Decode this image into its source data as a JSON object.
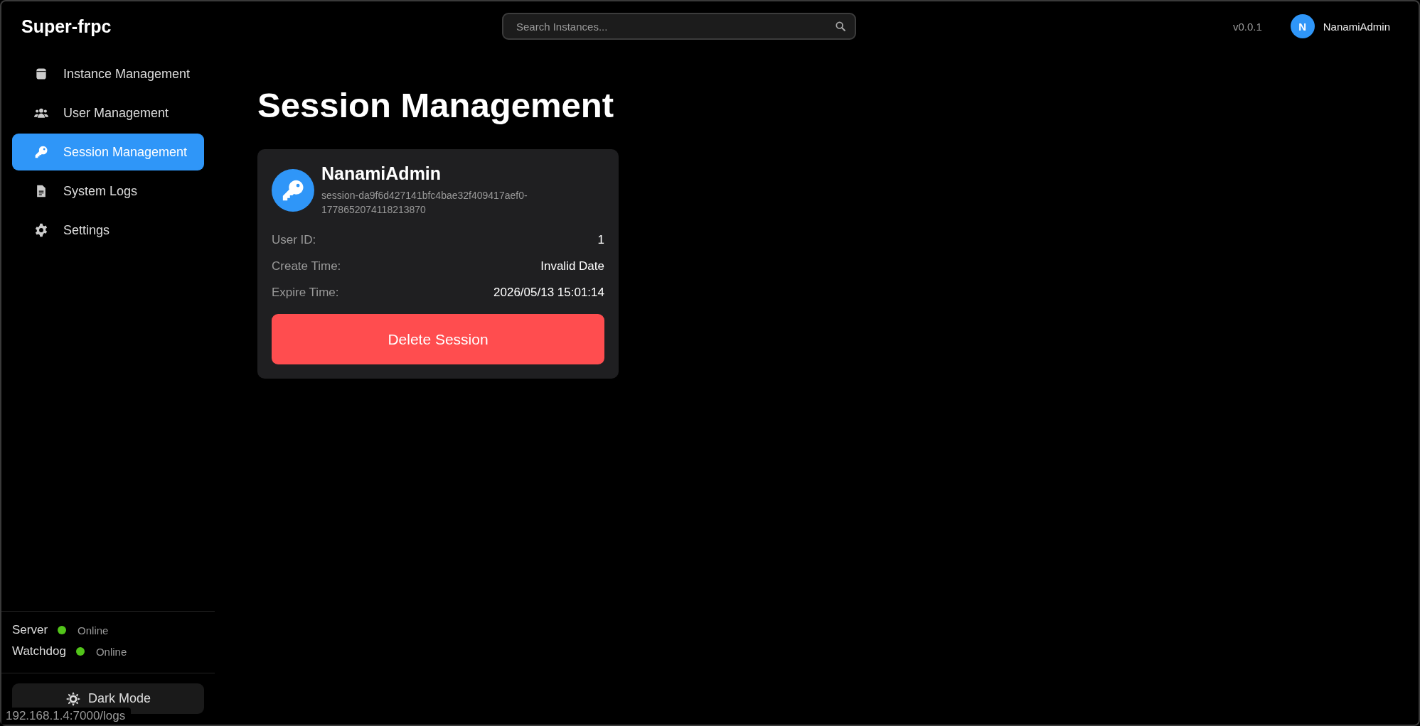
{
  "app": {
    "title": "Super-frpc"
  },
  "search": {
    "placeholder": "Search Instances..."
  },
  "header": {
    "version": "v0.0.1",
    "user": {
      "initial": "N",
      "name": "NanamiAdmin"
    }
  },
  "sidebar": {
    "items": [
      {
        "label": "Instance Management",
        "selected": false
      },
      {
        "label": "User Management",
        "selected": false
      },
      {
        "label": "Session Management",
        "selected": true
      },
      {
        "label": "System Logs",
        "selected": false
      },
      {
        "label": "Settings",
        "selected": false
      }
    ],
    "services": [
      {
        "name": "Server",
        "status": "Online",
        "color": "#52c41a"
      },
      {
        "name": "Watchdog",
        "status": "Online",
        "color": "#52c41a"
      }
    ],
    "theme_button": "Dark Mode"
  },
  "page": {
    "title": "Session Management",
    "sessions": [
      {
        "user": "NanamiAdmin",
        "session_id": "session-da9f6d427141bfc4bae32f409417aef0-1778652074118213870",
        "fields": [
          {
            "label": "User ID:",
            "value": "1"
          },
          {
            "label": "Create Time:",
            "value": "Invalid Date"
          },
          {
            "label": "Expire Time:",
            "value": "2026/05/13 15:01:14"
          }
        ],
        "action": "Delete Session"
      }
    ]
  },
  "status_url": "192.168.1.4:7000/logs"
}
